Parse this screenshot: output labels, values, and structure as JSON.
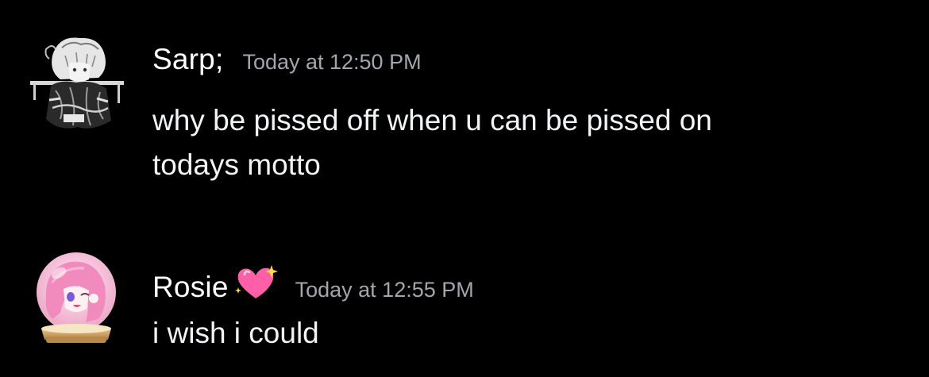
{
  "messages": [
    {
      "author": "Sarp;",
      "timestamp": "Today at 12:50 PM",
      "avatar": "grayscale-anime-character-avatar",
      "lines": [
        "why be pissed off when u can be pissed on",
        "todays motto"
      ]
    },
    {
      "author": "Rosie",
      "badge": "sparkling-heart-emoji",
      "timestamp": "Today at 12:55 PM",
      "avatar": "pink-anime-girl-snow-globe-avatar",
      "lines": [
        "i wish i could"
      ]
    }
  ],
  "colors": {
    "background": "#000000",
    "username": "#ffffff",
    "timestamp": "#a3a6ad",
    "message_text": "#f2f3f5",
    "heart_pink": "#ff5fa8"
  }
}
